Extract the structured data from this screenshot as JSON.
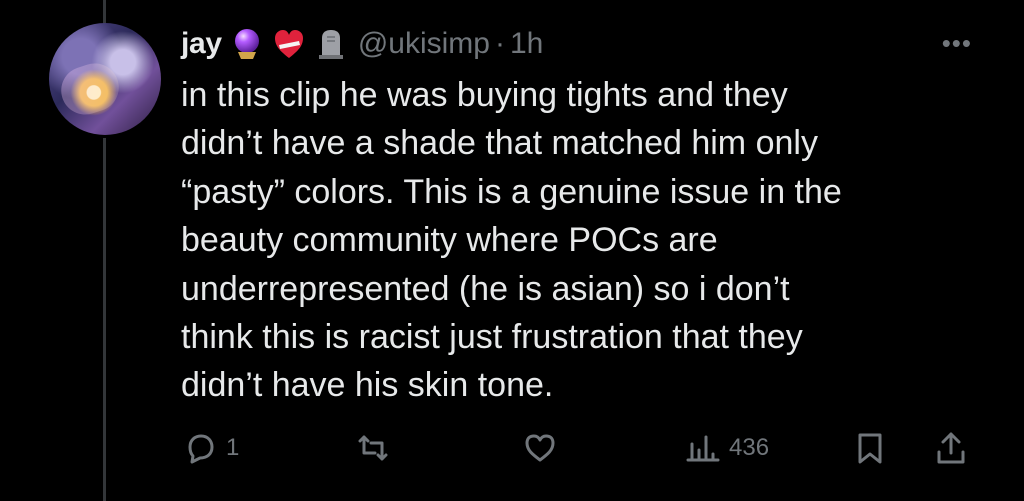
{
  "tweet": {
    "author_name": "jay",
    "handle": "@ukisimp",
    "separator": "·",
    "timestamp": "1h",
    "badges": [
      "crystal-ball-icon",
      "mending-heart-icon",
      "headstone-icon"
    ],
    "more_label": "•••",
    "text_lines": [
      "in this clip he was buying tights and they",
      "didn’t have a shade that matched him only",
      "“pasty” colors. This is a genuine issue in the",
      "beauty community where POCs are",
      "underrepresented (he is asian) so i don’t",
      "think this is racist just frustration that they",
      "didn’t have his skin tone."
    ]
  },
  "actions": {
    "reply": {
      "icon": "reply-icon",
      "count": "1"
    },
    "repost": {
      "icon": "repost-icon",
      "count": ""
    },
    "like": {
      "icon": "heart-icon",
      "count": ""
    },
    "views": {
      "icon": "views-icon",
      "count": "436"
    },
    "bookmark": {
      "icon": "bookmark-icon"
    },
    "share": {
      "icon": "share-icon"
    }
  },
  "colors": {
    "background": "#000000",
    "text": "#e7e9ea",
    "muted": "#71767b",
    "thread_line": "#333639"
  }
}
